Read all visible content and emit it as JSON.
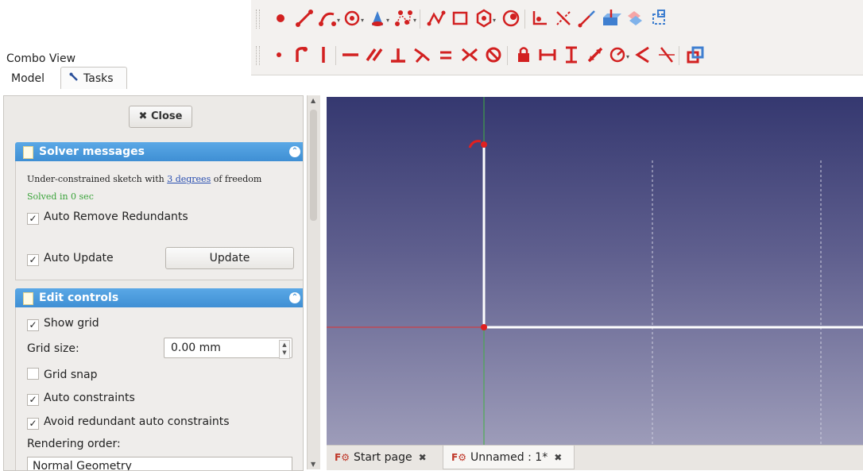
{
  "combo_view": {
    "title": "Combo View",
    "tabs": [
      {
        "label": "Model",
        "active": false
      },
      {
        "label": "Tasks",
        "active": true
      }
    ]
  },
  "task_panel": {
    "close_label": "Close",
    "solver_messages": {
      "title": "Solver messages",
      "message_prefix": "Under-constrained sketch with",
      "message_link": "3 degrees",
      "message_suffix": "of freedom",
      "solved_text": "Solved in 0 sec",
      "auto_remove_redundants": {
        "label": "Auto Remove Redundants",
        "checked": true
      },
      "auto_update": {
        "label": "Auto Update",
        "checked": true
      },
      "update_button": "Update"
    },
    "edit_controls": {
      "title": "Edit controls",
      "show_grid": {
        "label": "Show grid",
        "checked": true
      },
      "grid_size_label": "Grid size:",
      "grid_size_value": "0.00 mm",
      "grid_snap": {
        "label": "Grid snap",
        "checked": false
      },
      "auto_constraints": {
        "label": "Auto constraints",
        "checked": true
      },
      "avoid_redundant": {
        "label": "Avoid redundant auto constraints",
        "checked": true
      },
      "rendering_order_label": "Rendering order:",
      "rendering_order_value": "Normal Geometry"
    }
  },
  "toolbar": {
    "row1_icons": [
      "point-icon",
      "line-icon",
      "arc-icon",
      "circle-icon",
      "conic-icon",
      "bspline-icon",
      "polyline-icon",
      "rectangle-icon",
      "polygon-icon",
      "slot-icon",
      "fillet-icon",
      "trim-icon",
      "extend-icon",
      "external-geometry-icon",
      "carbon-copy-icon",
      "construction-mode-icon"
    ],
    "row2_icons": [
      "constrain-coincident-icon",
      "constrain-point-on-object-icon",
      "constrain-vertical-icon",
      "constrain-horizontal-icon",
      "constrain-parallel-icon",
      "constrain-perpendicular-icon",
      "constrain-tangent-icon",
      "constrain-equal-icon",
      "constrain-symmetric-icon",
      "constrain-block-icon",
      "constrain-lock-icon",
      "constrain-horizontal-distance-icon",
      "constrain-vertical-distance-icon",
      "constrain-distance-icon",
      "constrain-radius-icon",
      "constrain-angle-icon",
      "constrain-snell-icon",
      "toggle-driving-icon"
    ],
    "accent_color": "#d22020"
  },
  "document_tabs": [
    {
      "label": "Start page",
      "active": false
    },
    {
      "label": "Unnamed : 1*",
      "active": true
    }
  ],
  "colors": {
    "section_header": "#4a9be0",
    "solved_text": "#3aa33a",
    "link": "#2a4fb0",
    "sketch_point": "#e02020",
    "x_axis": "#e03030",
    "y_axis": "#40b040"
  }
}
